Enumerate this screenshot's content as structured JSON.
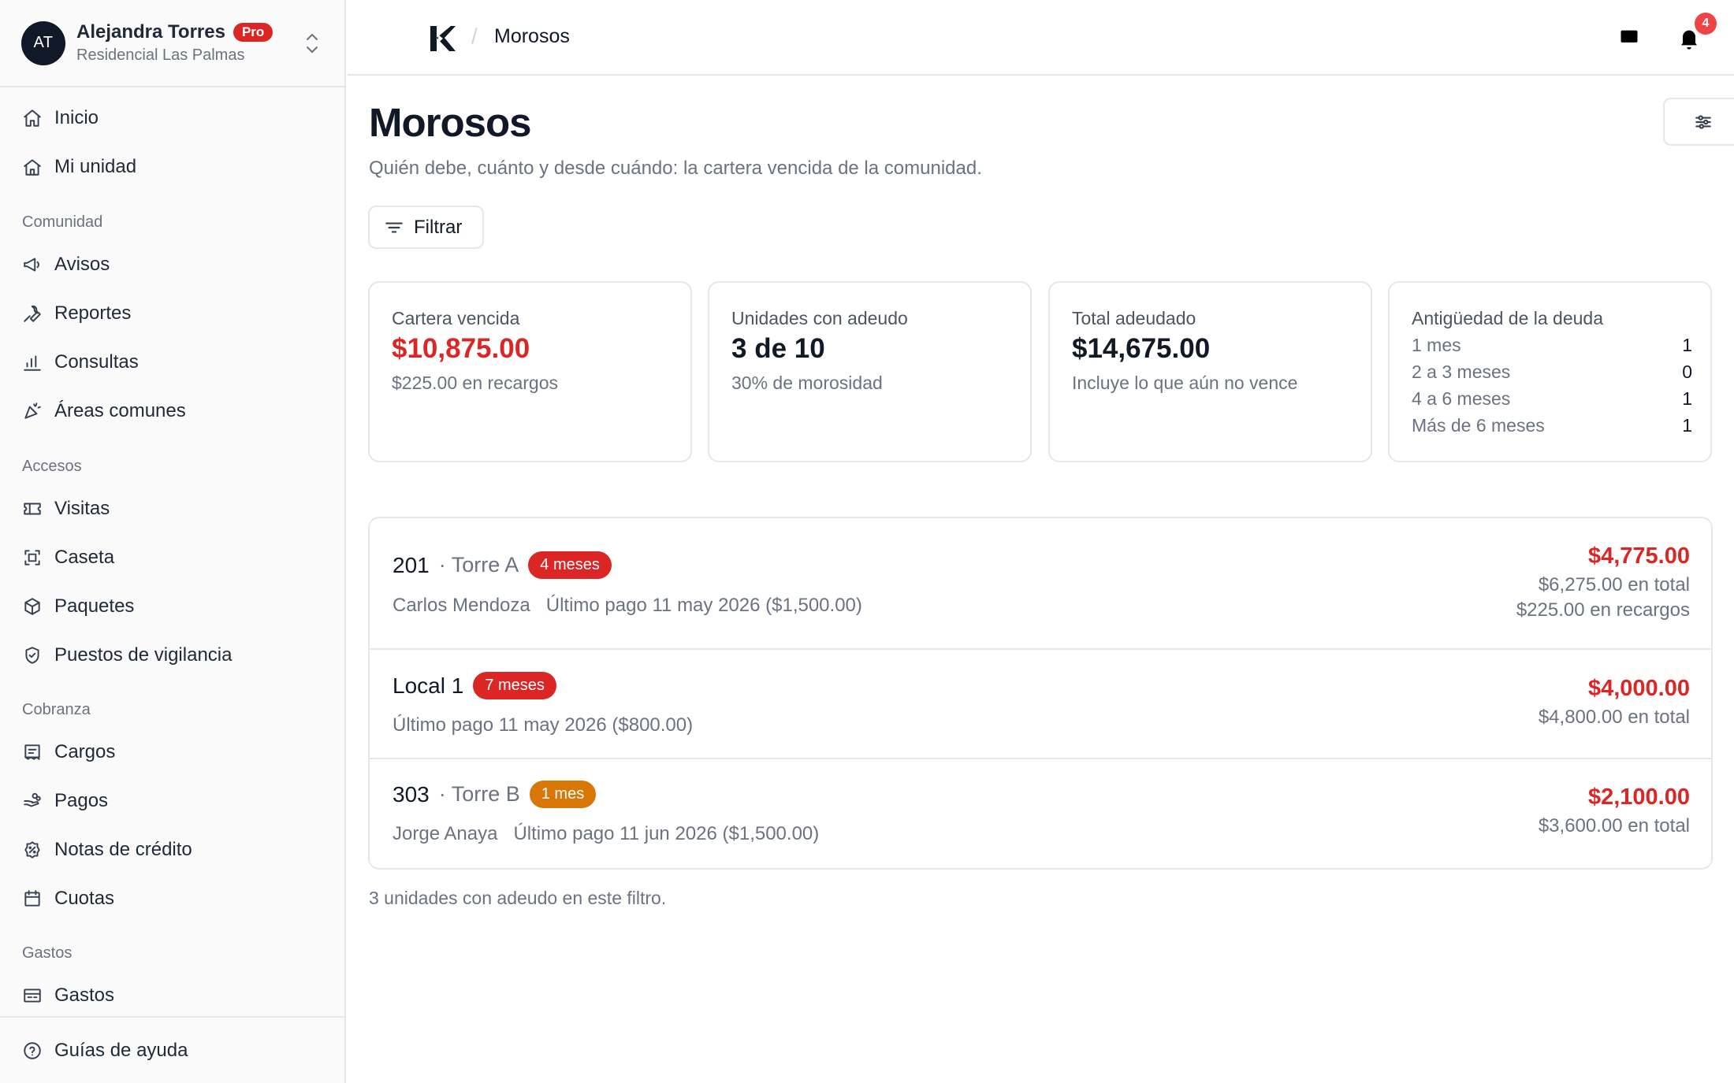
{
  "user": {
    "initials": "AT",
    "name": "Alejandra Torres",
    "plan_badge": "Pro",
    "community": "Residencial Las Palmas"
  },
  "nav": {
    "top": [
      {
        "label": "Inicio",
        "icon": "home-icon"
      },
      {
        "label": "Mi unidad",
        "icon": "house-icon"
      }
    ],
    "sections": [
      {
        "title": "Comunidad",
        "items": [
          {
            "label": "Avisos",
            "icon": "megaphone-icon"
          },
          {
            "label": "Reportes",
            "icon": "wrench-icon"
          },
          {
            "label": "Consultas",
            "icon": "bar-chart-icon"
          },
          {
            "label": "Áreas comunes",
            "icon": "party-icon"
          }
        ]
      },
      {
        "title": "Accesos",
        "items": [
          {
            "label": "Visitas",
            "icon": "ticket-icon"
          },
          {
            "label": "Caseta",
            "icon": "scan-icon"
          },
          {
            "label": "Paquetes",
            "icon": "package-icon"
          },
          {
            "label": "Puestos de vigilancia",
            "icon": "shield-icon"
          }
        ]
      },
      {
        "title": "Cobranza",
        "items": [
          {
            "label": "Cargos",
            "icon": "receipt-icon"
          },
          {
            "label": "Pagos",
            "icon": "hand-coins-icon"
          },
          {
            "label": "Notas de crédito",
            "icon": "discount-icon"
          },
          {
            "label": "Cuotas",
            "icon": "calendar-icon"
          }
        ]
      },
      {
        "title": "Gastos",
        "items": [
          {
            "label": "Gastos",
            "icon": "expenses-icon"
          }
        ]
      }
    ],
    "footer": {
      "label": "Guías de ayuda",
      "icon": "help-circle-icon"
    }
  },
  "topbar": {
    "breadcrumb": "Morosos",
    "notification_count": "4"
  },
  "page": {
    "title": "Morosos",
    "subtitle": "Quién debe, cuánto y desde cuándo: la cartera vencida de la comunidad.",
    "filter_label": "Filtrar"
  },
  "cards": {
    "overdue": {
      "label": "Cartera vencida",
      "value": "$10,875.00",
      "note": "$225.00 en recargos"
    },
    "units": {
      "label": "Unidades con adeudo",
      "value": "3 de 10",
      "note": "30% de morosidad"
    },
    "total": {
      "label": "Total adeudado",
      "value": "$14,675.00",
      "note": "Incluye lo que aún no vence"
    },
    "aging": {
      "label": "Antigüedad de la deuda",
      "rows": [
        {
          "label": "1 mes",
          "count": "1"
        },
        {
          "label": "2 a 3 meses",
          "count": "0"
        },
        {
          "label": "4 a 6 meses",
          "count": "1"
        },
        {
          "label": "Más de 6 meses",
          "count": "1"
        }
      ]
    }
  },
  "debtors": [
    {
      "unit": "201",
      "tower": "· Torre A",
      "badge": "4 meses",
      "badge_color": "#dc2626",
      "owner": "Carlos Mendoza",
      "last_payment": "Último pago 11 may 2026 ($1,500.00)",
      "overdue": "$4,775.00",
      "total": "$6,275.00 en total",
      "surcharges": "$225.00 en recargos"
    },
    {
      "unit": "Local 1",
      "tower": "",
      "badge": "7 meses",
      "badge_color": "#dc2626",
      "owner": "",
      "last_payment": "Último pago 11 may 2026 ($800.00)",
      "overdue": "$4,000.00",
      "total": "$4,800.00 en total",
      "surcharges": ""
    },
    {
      "unit": "303",
      "tower": "· Torre B",
      "badge": "1 mes",
      "badge_color": "#d97706",
      "owner": "Jorge Anaya",
      "last_payment": "Último pago 11 jun 2026 ($1,500.00)",
      "overdue": "$2,100.00",
      "total": "$3,600.00 en total",
      "surcharges": ""
    }
  ],
  "footnote": "3 unidades con adeudo en este filtro.",
  "colors": {
    "accent_red": "#dc2626",
    "amber": "#d97706",
    "border": "#e5e7eb"
  }
}
